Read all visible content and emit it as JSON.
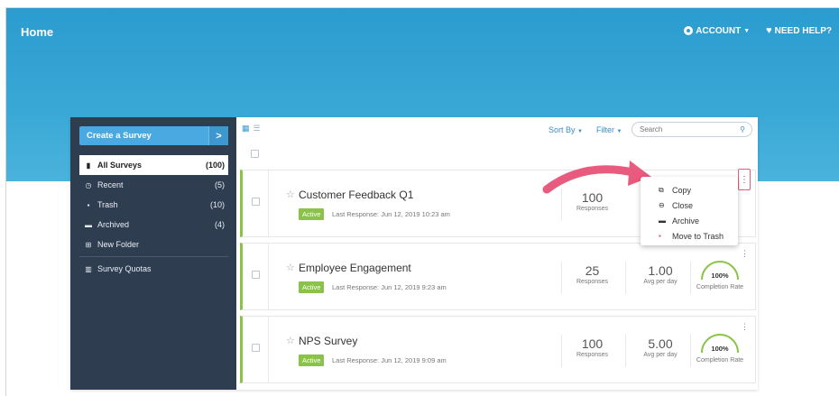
{
  "header": {
    "title": "Home",
    "account_label": "ACCOUNT",
    "help_label": "NEED HELP?"
  },
  "sidebar": {
    "create_label": "Create a Survey",
    "create_arrow": ">",
    "items": [
      {
        "label": "All Surveys",
        "count": "(100)",
        "icon": "file-icon"
      },
      {
        "label": "Recent",
        "count": "(5)",
        "icon": "clock-icon"
      },
      {
        "label": "Trash",
        "count": "(10)",
        "icon": "trash-icon"
      },
      {
        "label": "Archived",
        "count": "(4)",
        "icon": "archive-icon"
      },
      {
        "label": "New Folder",
        "count": "",
        "icon": "plus-folder-icon"
      },
      {
        "label": "Survey Quotas",
        "count": "",
        "icon": "bar-chart-icon"
      }
    ]
  },
  "toolbar": {
    "sort_label": "Sort By",
    "filter_label": "Filter",
    "search_placeholder": "Search"
  },
  "surveys": [
    {
      "title": "Customer Feedback Q1",
      "status": "Active",
      "last_response": "Last Response: Jun 12, 2019 10:23 am",
      "responses": "100",
      "responses_label": "Responses"
    },
    {
      "title": "Employee Engagement",
      "status": "Active",
      "last_response": "Last Response: Jun 12, 2019 9:23 am",
      "responses": "25",
      "responses_label": "Responses",
      "avg": "1.00",
      "avg_label": "Avg per day",
      "completion": "100%",
      "completion_fraction": 1.0,
      "completion_label": "Completion Rate"
    },
    {
      "title": "NPS Survey",
      "status": "Active",
      "last_response": "Last Response: Jun 12, 2019 9:09 am",
      "responses": "100",
      "responses_label": "Responses",
      "avg": "5.00",
      "avg_label": "Avg per day",
      "completion": "100%",
      "completion_fraction": 1.0,
      "completion_label": "Completion Rate"
    }
  ],
  "context_menu": {
    "items": [
      {
        "label": "Copy",
        "icon": "copy-icon"
      },
      {
        "label": "Close",
        "icon": "close-circle-icon"
      },
      {
        "label": "Archive",
        "icon": "archive-icon"
      },
      {
        "label": "Move to Trash",
        "icon": "trash-icon"
      }
    ]
  },
  "colors": {
    "hero": "#3aa8d6",
    "sidebar": "#2f3d51",
    "accent_green": "#8bc34a",
    "link_blue": "#3a8fc9",
    "callout_pink": "#e85a7e"
  }
}
